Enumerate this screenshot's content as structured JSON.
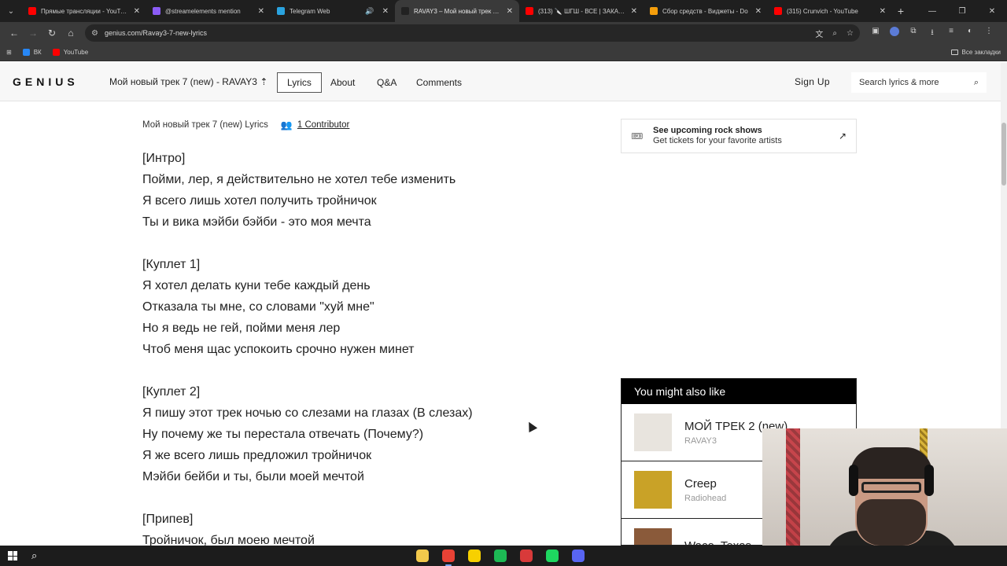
{
  "browser": {
    "tabs": [
      {
        "title": "Прямые трансляции - YouTube",
        "fav_color": "#ff0000",
        "active": false,
        "sound": false
      },
      {
        "title": "@streamelements mention",
        "fav_color": "#8b5cf6",
        "active": false,
        "sound": false
      },
      {
        "title": "Telegram Web",
        "fav_color": "#2aa3df",
        "active": false,
        "sound": true
      },
      {
        "title": "RAVAY3 – Мой новый трек 7 (n",
        "fav_color": "#222222",
        "active": true,
        "sound": false
      },
      {
        "title": "(313) 🔪 ШГШ - ВСЕ | ЗАКАЗ Р",
        "fav_color": "#ff0000",
        "active": false,
        "sound": false
      },
      {
        "title": "Сбор средств - Виджеты - Do",
        "fav_color": "#f59e0b",
        "active": false,
        "sound": false
      },
      {
        "title": "(315) Crunvich - YouTube",
        "fav_color": "#ff0000",
        "active": false,
        "sound": false
      }
    ],
    "new_tab_label": "+",
    "url": "genius.com/Ravay3-7-new-lyrics",
    "bookmarks": [
      {
        "label": "ВК",
        "color": "#2787f5"
      },
      {
        "label": "YouTube",
        "color": "#ff0000"
      }
    ],
    "all_bookmarks_label": "Все закладки"
  },
  "genius": {
    "logo": "GENIUS",
    "song_header": "Мой новый трек 7 (new) - RAVAY3",
    "nav_tabs": [
      {
        "label": "Lyrics",
        "active": true
      },
      {
        "label": "About",
        "active": false
      },
      {
        "label": "Q&A",
        "active": false
      },
      {
        "label": "Comments",
        "active": false
      }
    ],
    "sign_up": "Sign Up",
    "search_placeholder": "Search lyrics & more"
  },
  "lyrics": {
    "title": "Мой новый трек 7 (new) Lyrics",
    "contributors": "1 Contributor",
    "lines": [
      "[Интро]",
      "Пойми, лер, я действительно не хотел тебе изменить",
      "Я всего лишь хотел получить тройничок",
      "Ты и вика мэйби бэйби - это моя мечта",
      "",
      "[Куплет 1]",
      "Я хотел делать куни тебе каждый день",
      "Отказала ты мне, со словами \"хуй мне\"",
      "Но я ведь не гей, пойми меня лер",
      "Чтоб меня щас успокоить срочно нужен минет",
      "",
      "[Куплет 2]",
      "Я пишу этот трек ночью со слезами на глазах (В слезах)",
      "Ну почему же ты перестала отвечать (Почему?)",
      "Я же всего лишь предложил тройничок",
      "Мэйби бейби и ты, были моей мечтой",
      "",
      "[Припев]",
      "Тройничок, был моею мечтой"
    ]
  },
  "promo": {
    "title": "See upcoming rock shows",
    "subtitle": "Get tickets for your favorite artists"
  },
  "might_like": {
    "heading": "You might also like",
    "items": [
      {
        "title": "МОЙ ТРЕК 2 (new)",
        "artist": "RAVAY3",
        "art_color": "#e8e4de"
      },
      {
        "title": "Creep",
        "artist": "Radiohead",
        "art_color": "#c9a227"
      },
      {
        "title": "Waco, Texas",
        "artist": "",
        "art_color": "#8a5a3a"
      }
    ]
  },
  "taskbar": {
    "apps": [
      {
        "name": "file-explorer",
        "color": "#f2c94c",
        "active": false
      },
      {
        "name": "chrome",
        "color": "#e94235",
        "active": true
      },
      {
        "name": "app-yellow",
        "color": "#f7d000",
        "active": false
      },
      {
        "name": "app-green-circle",
        "color": "#1db954",
        "active": false
      },
      {
        "name": "app-red",
        "color": "#d83a3a",
        "active": false
      },
      {
        "name": "spotify",
        "color": "#1ed760",
        "active": false
      },
      {
        "name": "discord",
        "color": "#5865f2",
        "active": false
      }
    ]
  }
}
